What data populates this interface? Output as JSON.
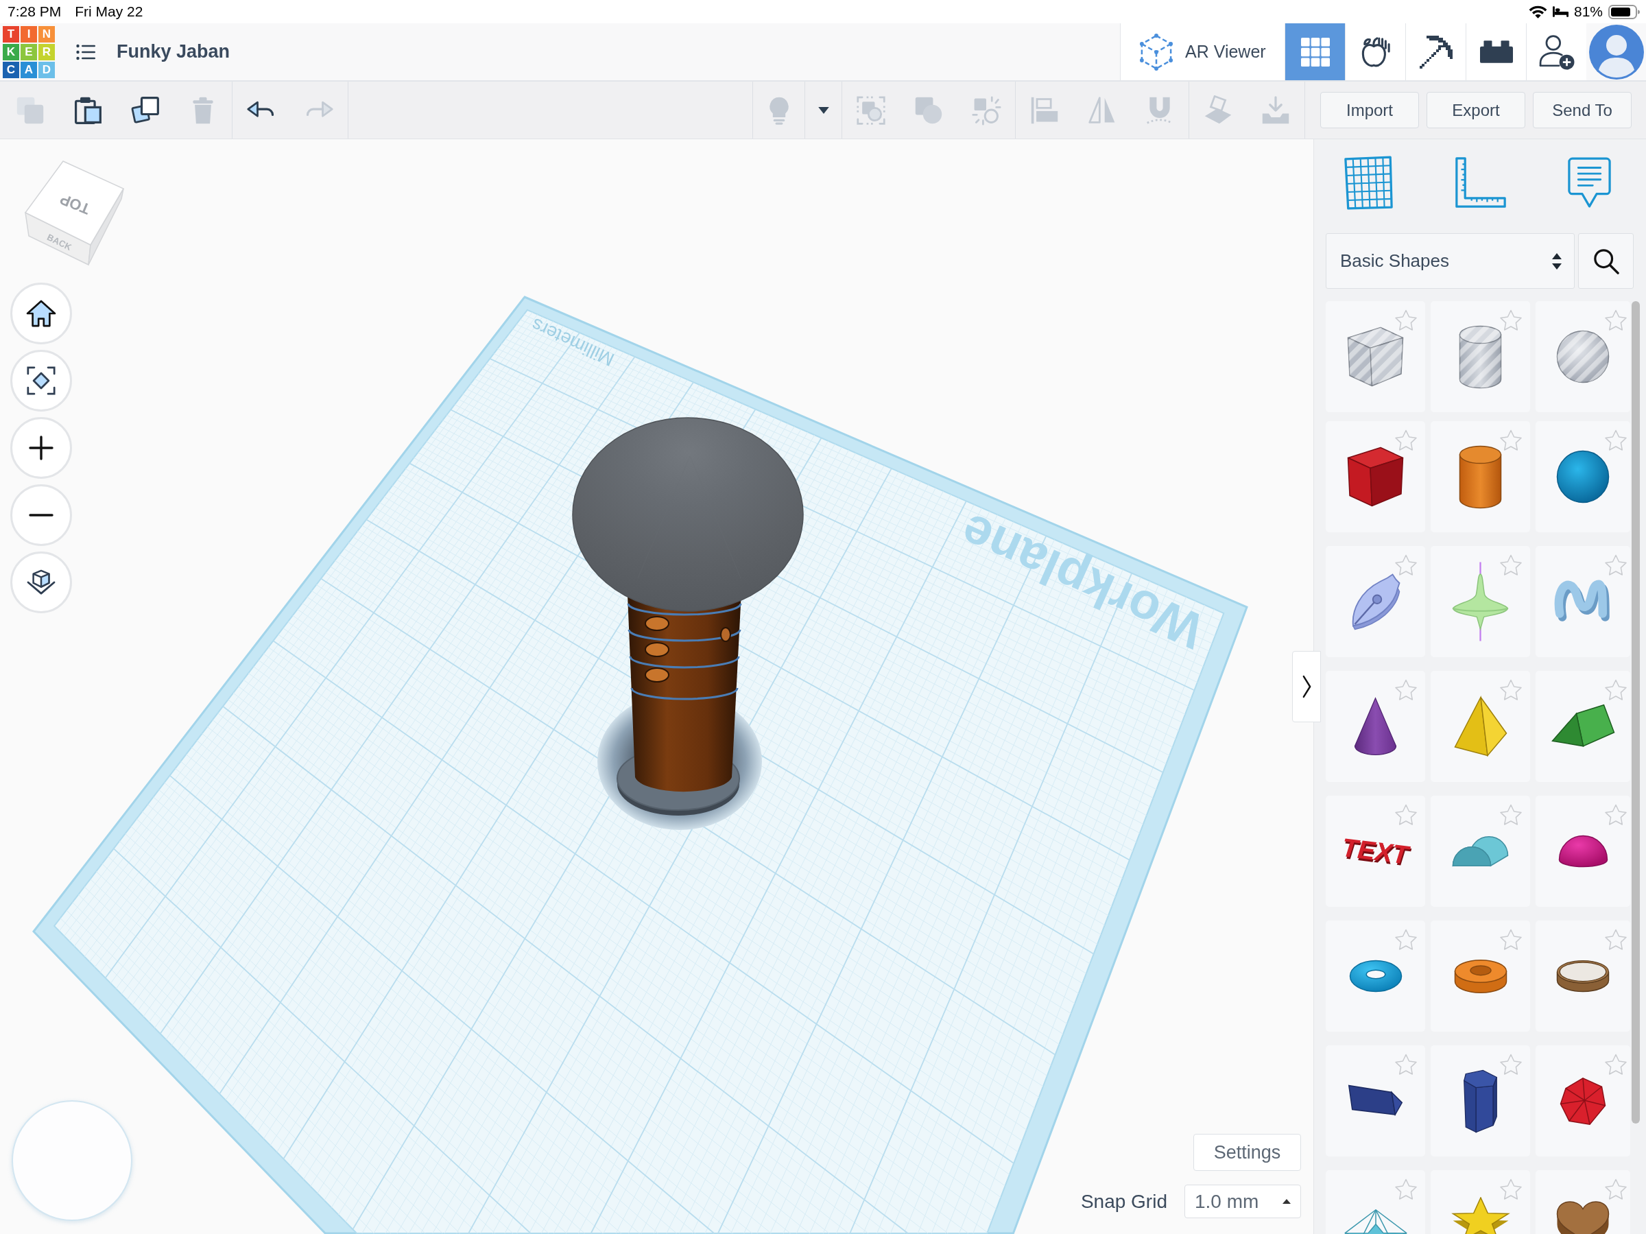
{
  "status_bar": {
    "time": "7:28 PM",
    "date": "Fri May 22",
    "battery": "81%"
  },
  "header": {
    "logo": [
      {
        "letter": "T",
        "color": "#e8432e"
      },
      {
        "letter": "I",
        "color": "#f26a30"
      },
      {
        "letter": "N",
        "color": "#f7903a"
      },
      {
        "letter": "K",
        "color": "#3aaa4a"
      },
      {
        "letter": "E",
        "color": "#8cc63e"
      },
      {
        "letter": "R",
        "color": "#c4d32e"
      },
      {
        "letter": "C",
        "color": "#1b62b0"
      },
      {
        "letter": "A",
        "color": "#2a8fd6"
      },
      {
        "letter": "D",
        "color": "#6cbfe9"
      }
    ],
    "title": "Funky Jaban",
    "ar_viewer": "AR Viewer",
    "modes": [
      {
        "kind": "grid",
        "selected": true
      },
      {
        "kind": "apple",
        "selected": false
      },
      {
        "kind": "pickaxe",
        "selected": false
      },
      {
        "kind": "brick",
        "selected": false
      }
    ]
  },
  "toolbar": {
    "left_groups": [
      [
        {
          "kind": "copy",
          "disabled": true
        },
        {
          "kind": "paste",
          "disabled": false
        },
        {
          "kind": "duplicate",
          "disabled": false
        },
        {
          "kind": "delete",
          "disabled": true
        }
      ],
      [
        {
          "kind": "undo",
          "disabled": false
        },
        {
          "kind": "redo",
          "disabled": true
        }
      ]
    ],
    "right_groups": [
      [
        {
          "kind": "bulb",
          "disabled": true
        }
      ],
      [
        {
          "kind": "dropdown",
          "disabled": false
        }
      ],
      [
        {
          "kind": "group",
          "disabled": true
        },
        {
          "kind": "combine",
          "disabled": true
        },
        {
          "kind": "ungroup",
          "disabled": true
        }
      ],
      [
        {
          "kind": "align",
          "disabled": true
        },
        {
          "kind": "mirror",
          "disabled": true
        },
        {
          "kind": "magnet",
          "disabled": true
        }
      ],
      [
        {
          "kind": "workplane",
          "disabled": true
        },
        {
          "kind": "drop",
          "disabled": true
        }
      ]
    ],
    "buttons": [
      "Import",
      "Export",
      "Send To"
    ]
  },
  "viewport": {
    "view_cube": {
      "top": "TOP",
      "back": "BACK"
    },
    "workplane": {
      "label": "Workplane",
      "units": "Millimeters"
    },
    "settings": "Settings",
    "snap_grid": {
      "label": "Snap Grid",
      "value": "1.0 mm"
    }
  },
  "library": {
    "category": "Basic Shapes",
    "shapes": [
      {
        "kind": "box-hole",
        "starred": false
      },
      {
        "kind": "cylinder-hole",
        "starred": false
      },
      {
        "kind": "sphere-hole",
        "starred": false
      },
      {
        "kind": "box",
        "starred": false
      },
      {
        "kind": "cylinder",
        "starred": false
      },
      {
        "kind": "sphere",
        "starred": false
      },
      {
        "kind": "nib",
        "starred": false
      },
      {
        "kind": "spinning-top",
        "starred": false
      },
      {
        "kind": "squiggle",
        "starred": false
      },
      {
        "kind": "cone",
        "starred": false
      },
      {
        "kind": "pyramid",
        "starred": false
      },
      {
        "kind": "roof",
        "starred": false
      },
      {
        "kind": "text",
        "label": "TEXT",
        "starred": false
      },
      {
        "kind": "half-cylinder",
        "starred": false
      },
      {
        "kind": "hemisphere",
        "starred": false
      },
      {
        "kind": "torus",
        "starred": false
      },
      {
        "kind": "tube",
        "starred": false
      },
      {
        "kind": "ring",
        "starred": false
      },
      {
        "kind": "prism",
        "starred": false
      },
      {
        "kind": "hex-prism",
        "starred": false
      },
      {
        "kind": "icosahedron",
        "starred": false
      },
      {
        "kind": "star-pyramid",
        "starred": false
      },
      {
        "kind": "star",
        "starred": false
      },
      {
        "kind": "heart",
        "starred": false
      }
    ]
  }
}
